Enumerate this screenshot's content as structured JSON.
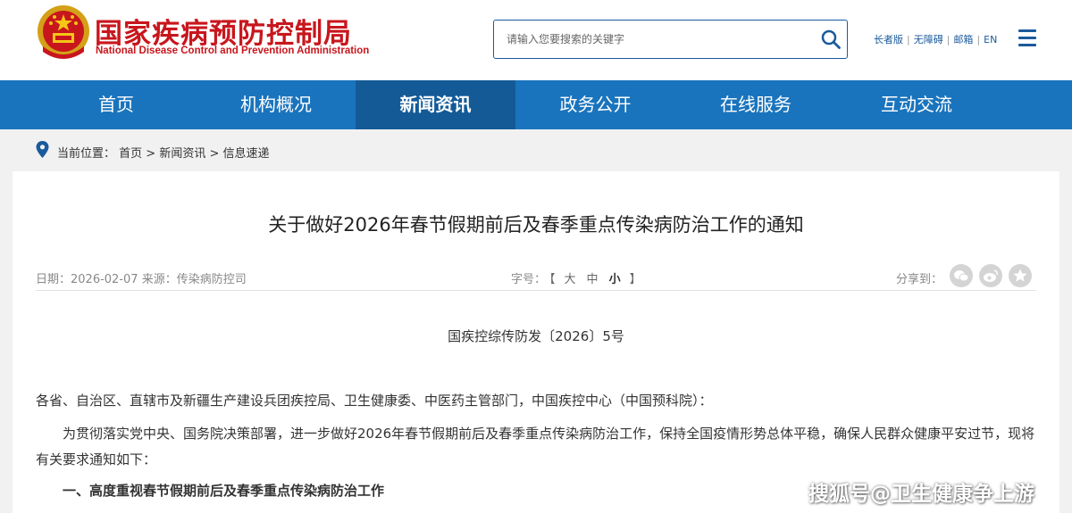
{
  "header": {
    "title_cn": "国家疾病预防控制局",
    "title_en": "National Disease Control and Prevention Administration",
    "search": {
      "placeholder": "请输入您要搜索的关键字"
    },
    "top_links": [
      "长者版",
      "无障碍",
      "邮箱",
      "EN"
    ],
    "brand_color": "#c8161d"
  },
  "nav": {
    "items": [
      "首页",
      "机构概况",
      "新闻资讯",
      "政务公开",
      "在线服务",
      "互动交流"
    ],
    "active": "新闻资讯",
    "color": "#1a74bd",
    "active_color": "#135a97"
  },
  "breadcrumb": {
    "label": "当前位置：",
    "path": [
      "首页",
      "新闻资讯",
      "信息速递"
    ],
    "separator": " > "
  },
  "article": {
    "title": "关于做好2026年春节假期前后及春季重点传染病防治工作的通知",
    "date_label": "日期：",
    "date": "2026-02-07",
    "source_label": "来源：",
    "source": "传染病防控司",
    "font_size_label": "字号：",
    "font_sizes": [
      "大",
      "中",
      "小"
    ],
    "font_size_selected": "小",
    "share_label": "分享到：",
    "share_icons": [
      "wechat-icon",
      "weibo-icon",
      "favorite-icon"
    ],
    "doc_number": "国疾控综传防发〔2026〕5号",
    "recipients": "各省、自治区、直辖市及新疆生产建设兵团疾控局、卫生健康委、中医药主管部门，中国疾控中心（中国预科院）：",
    "intro": "为贯彻落实党中央、国务院决策部署，进一步做好2026年春节假期前后及春季重点传染病防治工作，保持全国疫情形势总体平稳，确保人民群众健康平安过节，现将有关要求通知如下：",
    "section_1": "一、高度重视春节假期前后及春季重点传染病防治工作"
  },
  "watermark": "搜狐号@卫生健康争上游"
}
